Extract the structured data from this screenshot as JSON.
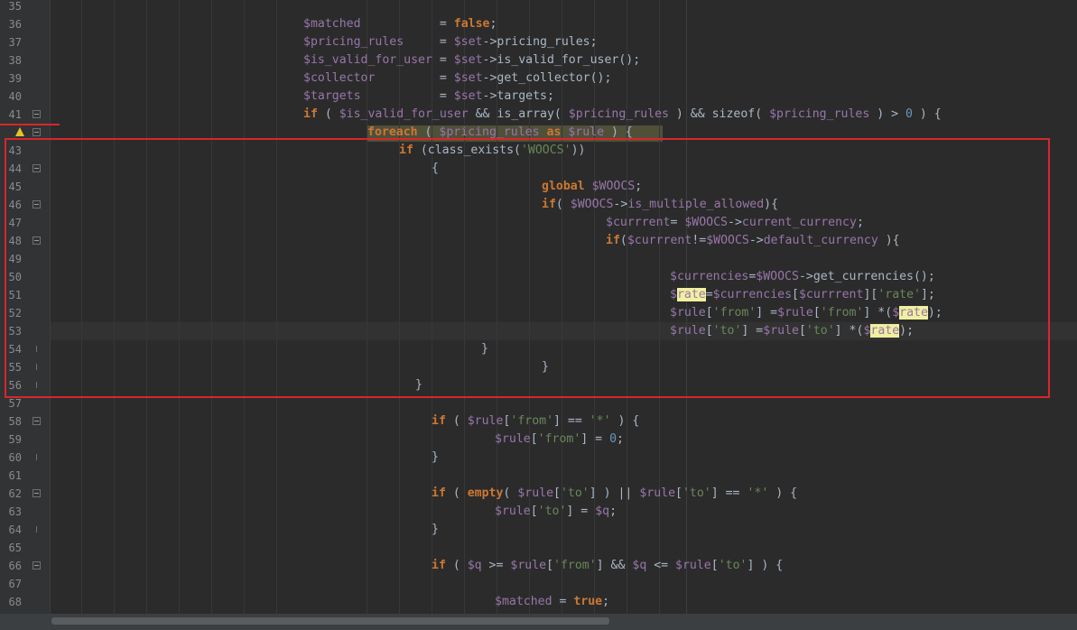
{
  "editor": {
    "lines": [
      {
        "num": "35",
        "indent": 0,
        "tokens": [],
        "fold": null
      },
      {
        "num": "36",
        "indent": 336,
        "fold": null,
        "tokens": [
          {
            "c": "v",
            "t": "$matched"
          },
          {
            "c": "p",
            "t": "           = "
          },
          {
            "c": "k",
            "t": "false"
          },
          {
            "c": "p",
            "t": ";"
          }
        ]
      },
      {
        "num": "37",
        "indent": 336,
        "fold": null,
        "tokens": [
          {
            "c": "v",
            "t": "$pricing_rules"
          },
          {
            "c": "p",
            "t": "     = "
          },
          {
            "c": "v",
            "t": "$set"
          },
          {
            "c": "p",
            "t": "->pricing_rules;"
          }
        ]
      },
      {
        "num": "38",
        "indent": 336,
        "fold": null,
        "tokens": [
          {
            "c": "v",
            "t": "$is_valid_for_user"
          },
          {
            "c": "p",
            "t": " = "
          },
          {
            "c": "v",
            "t": "$set"
          },
          {
            "c": "p",
            "t": "->is_valid_for_user();"
          }
        ]
      },
      {
        "num": "39",
        "indent": 336,
        "fold": null,
        "tokens": [
          {
            "c": "v",
            "t": "$collector"
          },
          {
            "c": "p",
            "t": "         = "
          },
          {
            "c": "v",
            "t": "$set"
          },
          {
            "c": "p",
            "t": "->get_collector();"
          }
        ]
      },
      {
        "num": "40",
        "indent": 336,
        "fold": null,
        "tokens": [
          {
            "c": "v",
            "t": "$targets"
          },
          {
            "c": "p",
            "t": "           = "
          },
          {
            "c": "v",
            "t": "$set"
          },
          {
            "c": "p",
            "t": "->targets;"
          }
        ]
      },
      {
        "num": "41",
        "indent": 336,
        "fold": "open",
        "tokens": [
          {
            "c": "k",
            "t": "if"
          },
          {
            "c": "p",
            "t": " ( "
          },
          {
            "c": "v",
            "t": "$is_valid_for_user"
          },
          {
            "c": "p",
            "t": " && is_array( "
          },
          {
            "c": "v",
            "t": "$pricing_rules"
          },
          {
            "c": "p",
            "t": " ) && sizeof( "
          },
          {
            "c": "v",
            "t": "$pricing_rules"
          },
          {
            "c": "p",
            "t": " ) > "
          },
          {
            "c": "n",
            "t": "0"
          },
          {
            "c": "p",
            "t": " ) {"
          }
        ]
      },
      {
        "num": "",
        "indent": 407,
        "fold": "open",
        "warn": true,
        "tokens": [
          {
            "c": "k",
            "t": "foreach"
          },
          {
            "c": "p",
            "t": " ( "
          },
          {
            "c": "v",
            "t": "$pricing_rules"
          },
          {
            "c": "p",
            "t": " "
          },
          {
            "c": "k",
            "t": "as"
          },
          {
            "c": "p",
            "t": " "
          },
          {
            "c": "v",
            "t": "$rule"
          },
          {
            "c": "p",
            "t": " ) {"
          }
        ]
      },
      {
        "num": "43",
        "indent": 442,
        "fold": null,
        "tokens": [
          {
            "c": "k",
            "t": "if"
          },
          {
            "c": "p",
            "t": " (class_exists("
          },
          {
            "c": "s",
            "t": "'WOOCS'"
          },
          {
            "c": "p",
            "t": "))"
          }
        ]
      },
      {
        "num": "44",
        "indent": 478,
        "fold": "open",
        "tokens": [
          {
            "c": "p",
            "t": "{"
          }
        ]
      },
      {
        "num": "45",
        "indent": 600,
        "fold": null,
        "tokens": [
          {
            "c": "k",
            "t": "global"
          },
          {
            "c": "p",
            "t": " "
          },
          {
            "c": "v",
            "t": "$WOOCS"
          },
          {
            "c": "p",
            "t": ";"
          }
        ]
      },
      {
        "num": "46",
        "indent": 600,
        "fold": "open",
        "tokens": [
          {
            "c": "k",
            "t": "if"
          },
          {
            "c": "p",
            "t": "( "
          },
          {
            "c": "v",
            "t": "$WOOCS"
          },
          {
            "c": "p",
            "t": "->"
          },
          {
            "c": "v",
            "t": "is_multiple_allowed"
          },
          {
            "c": "p",
            "t": "){"
          }
        ]
      },
      {
        "num": "47",
        "indent": 671,
        "fold": null,
        "tokens": [
          {
            "c": "v",
            "t": "$currrent"
          },
          {
            "c": "p",
            "t": "= "
          },
          {
            "c": "v",
            "t": "$WOOCS"
          },
          {
            "c": "p",
            "t": "->"
          },
          {
            "c": "v",
            "t": "current_currency"
          },
          {
            "c": "p",
            "t": ";"
          }
        ]
      },
      {
        "num": "48",
        "indent": 671,
        "fold": "open",
        "tokens": [
          {
            "c": "k",
            "t": "if"
          },
          {
            "c": "p",
            "t": "("
          },
          {
            "c": "v",
            "t": "$currrent"
          },
          {
            "c": "p",
            "t": "!="
          },
          {
            "c": "v",
            "t": "$WOOCS"
          },
          {
            "c": "p",
            "t": "->"
          },
          {
            "c": "v",
            "t": "default_currency"
          },
          {
            "c": "p",
            "t": " ){"
          }
        ]
      },
      {
        "num": "49",
        "indent": 0,
        "fold": null,
        "tokens": []
      },
      {
        "num": "50",
        "indent": 742,
        "fold": null,
        "tokens": [
          {
            "c": "v",
            "t": "$currencies"
          },
          {
            "c": "p",
            "t": "="
          },
          {
            "c": "v",
            "t": "$WOOCS"
          },
          {
            "c": "p",
            "t": "->get_currencies();"
          }
        ]
      },
      {
        "num": "51",
        "indent": 742,
        "fold": null,
        "tokens": [
          {
            "c": "v",
            "t": "$"
          },
          {
            "c": "h",
            "t": "rate"
          },
          {
            "c": "p",
            "t": "="
          },
          {
            "c": "v",
            "t": "$currencies"
          },
          {
            "c": "p",
            "t": "["
          },
          {
            "c": "v",
            "t": "$currrent"
          },
          {
            "c": "p",
            "t": "]["
          },
          {
            "c": "s",
            "t": "'rate'"
          },
          {
            "c": "p",
            "t": "];"
          }
        ]
      },
      {
        "num": "52",
        "indent": 742,
        "fold": null,
        "tokens": [
          {
            "c": "v",
            "t": "$rule"
          },
          {
            "c": "p",
            "t": "["
          },
          {
            "c": "s",
            "t": "'from'"
          },
          {
            "c": "p",
            "t": "] ="
          },
          {
            "c": "v",
            "t": "$rule"
          },
          {
            "c": "p",
            "t": "["
          },
          {
            "c": "s",
            "t": "'from'"
          },
          {
            "c": "p",
            "t": "] *("
          },
          {
            "c": "v",
            "t": "$"
          },
          {
            "c": "h",
            "t": "rate"
          },
          {
            "c": "p",
            "t": ");"
          }
        ]
      },
      {
        "num": "53",
        "indent": 742,
        "fold": null,
        "tokens": [
          {
            "c": "v",
            "t": "$rule"
          },
          {
            "c": "p",
            "t": "["
          },
          {
            "c": "s",
            "t": "'to'"
          },
          {
            "c": "p",
            "t": "] ="
          },
          {
            "c": "v",
            "t": "$rule"
          },
          {
            "c": "p",
            "t": "["
          },
          {
            "c": "s",
            "t": "'to'"
          },
          {
            "c": "p",
            "t": "] *("
          },
          {
            "c": "v",
            "t": "$"
          },
          {
            "c": "h",
            "t": "rate"
          },
          {
            "c": "p",
            "t": ");"
          }
        ]
      },
      {
        "num": "54",
        "indent": 533,
        "fold": "end",
        "tokens": [
          {
            "c": "p",
            "t": "}"
          }
        ]
      },
      {
        "num": "55",
        "indent": 600,
        "fold": "end",
        "tokens": [
          {
            "c": "p",
            "t": "}"
          }
        ]
      },
      {
        "num": "56",
        "indent": 460,
        "fold": "end",
        "tokens": [
          {
            "c": "p",
            "t": "}"
          }
        ]
      },
      {
        "num": "57",
        "indent": 0,
        "fold": null,
        "tokens": []
      },
      {
        "num": "58",
        "indent": 478,
        "fold": "open",
        "tokens": [
          {
            "c": "k",
            "t": "if"
          },
          {
            "c": "p",
            "t": " ( "
          },
          {
            "c": "v",
            "t": "$rule"
          },
          {
            "c": "p",
            "t": "["
          },
          {
            "c": "s",
            "t": "'from'"
          },
          {
            "c": "p",
            "t": "] == "
          },
          {
            "c": "s",
            "t": "'*'"
          },
          {
            "c": "p",
            "t": " ) {"
          }
        ]
      },
      {
        "num": "59",
        "indent": 548,
        "fold": null,
        "tokens": [
          {
            "c": "v",
            "t": "$rule"
          },
          {
            "c": "p",
            "t": "["
          },
          {
            "c": "s",
            "t": "'from'"
          },
          {
            "c": "p",
            "t": "] = "
          },
          {
            "c": "n",
            "t": "0"
          },
          {
            "c": "p",
            "t": ";"
          }
        ]
      },
      {
        "num": "60",
        "indent": 478,
        "fold": "end",
        "tokens": [
          {
            "c": "p",
            "t": "}"
          }
        ]
      },
      {
        "num": "61",
        "indent": 0,
        "fold": null,
        "tokens": []
      },
      {
        "num": "62",
        "indent": 478,
        "fold": "open",
        "tokens": [
          {
            "c": "k",
            "t": "if"
          },
          {
            "c": "p",
            "t": " ( "
          },
          {
            "c": "k",
            "t": "empty"
          },
          {
            "c": "p",
            "t": "( "
          },
          {
            "c": "v",
            "t": "$rule"
          },
          {
            "c": "p",
            "t": "["
          },
          {
            "c": "s",
            "t": "'to'"
          },
          {
            "c": "p",
            "t": "] ) || "
          },
          {
            "c": "v",
            "t": "$rule"
          },
          {
            "c": "p",
            "t": "["
          },
          {
            "c": "s",
            "t": "'to'"
          },
          {
            "c": "p",
            "t": "] == "
          },
          {
            "c": "s",
            "t": "'*'"
          },
          {
            "c": "p",
            "t": " ) {"
          }
        ]
      },
      {
        "num": "63",
        "indent": 548,
        "fold": null,
        "tokens": [
          {
            "c": "v",
            "t": "$rule"
          },
          {
            "c": "p",
            "t": "["
          },
          {
            "c": "s",
            "t": "'to'"
          },
          {
            "c": "p",
            "t": "] = "
          },
          {
            "c": "v",
            "t": "$q"
          },
          {
            "c": "p",
            "t": ";"
          }
        ]
      },
      {
        "num": "64",
        "indent": 478,
        "fold": "end",
        "tokens": [
          {
            "c": "p",
            "t": "}"
          }
        ]
      },
      {
        "num": "65",
        "indent": 0,
        "fold": null,
        "tokens": []
      },
      {
        "num": "66",
        "indent": 478,
        "fold": "open",
        "tokens": [
          {
            "c": "k",
            "t": "if"
          },
          {
            "c": "p",
            "t": " ( "
          },
          {
            "c": "v",
            "t": "$q"
          },
          {
            "c": "p",
            "t": " >= "
          },
          {
            "c": "v",
            "t": "$rule"
          },
          {
            "c": "p",
            "t": "["
          },
          {
            "c": "s",
            "t": "'from'"
          },
          {
            "c": "p",
            "t": "] && "
          },
          {
            "c": "v",
            "t": "$q"
          },
          {
            "c": "p",
            "t": " <= "
          },
          {
            "c": "v",
            "t": "$rule"
          },
          {
            "c": "p",
            "t": "["
          },
          {
            "c": "s",
            "t": "'to'"
          },
          {
            "c": "p",
            "t": "] ) {"
          }
        ]
      },
      {
        "num": "67",
        "indent": 0,
        "fold": null,
        "tokens": []
      },
      {
        "num": "68",
        "indent": 548,
        "fold": null,
        "tokens": [
          {
            "c": "v",
            "t": "$matched"
          },
          {
            "c": "p",
            "t": " = "
          },
          {
            "c": "k",
            "t": "true"
          },
          {
            "c": "p",
            "t": ";"
          }
        ]
      }
    ]
  },
  "colors": {
    "background": "#2b2b2b",
    "keyword": "#cc7832",
    "variable": "#9876aa",
    "string": "#6a8759",
    "number": "#6897bb",
    "highlight_box": "#d9262b"
  },
  "icons": {
    "warning": "warning-icon",
    "fold": "fold-toggle-icon"
  }
}
